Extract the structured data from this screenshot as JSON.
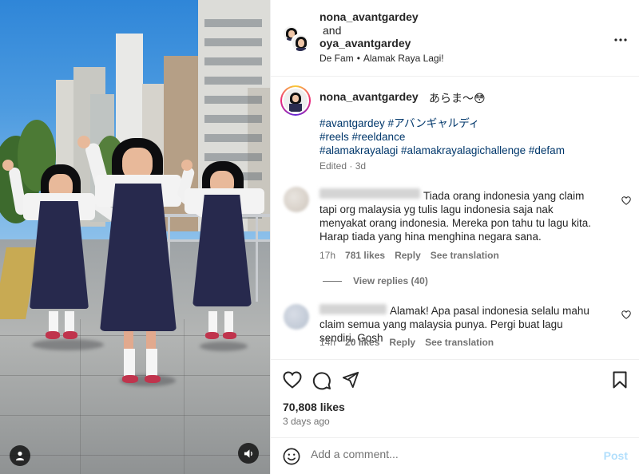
{
  "header": {
    "owner1": "nona_avantgardey",
    "connector": "and",
    "owner2": "oya_avantgardey",
    "audio_artist": "De Fam",
    "audio_separator": "•",
    "audio_title": "Alamak Raya Lagi!",
    "more_icon": "more-horizontal-icon"
  },
  "caption": {
    "username": "nona_avantgardey",
    "text": "あらま〜😳",
    "hashtags": [
      "#avantgardey #アバンギャルディ",
      "#reels #reeldance",
      "#alamakrayalagi #alamakrayalagichallenge #defam"
    ],
    "edited": "Edited · 3d"
  },
  "comments": [
    {
      "text": "Tiada orang indonesia yang claim tapi org malaysia yg tulis lagu indonesia saja nak menyakat orang indonesia. Mereka pon tahu tu lagu kita. Harap tiada yang hina menghina negara sana.",
      "time": "17h",
      "likes": "781 likes",
      "reply": "Reply",
      "translate": "See translation",
      "view_replies": "View replies (40)"
    },
    {
      "text": "Alamak! Apa pasal indonesia selalu mahu claim semua yang malaysia punya. Pergi buat lagu sendiri. Gosh",
      "time": "14h",
      "likes": "20 likes",
      "reply": "Reply",
      "translate": "See translation"
    }
  ],
  "actions": {
    "like_icon": "heart-icon",
    "comment_icon": "comment-icon",
    "share_icon": "share-icon",
    "save_icon": "bookmark-icon"
  },
  "stats": {
    "likes": "70,808 likes",
    "posted": "3 days ago"
  },
  "add_comment": {
    "placeholder": "Add a comment...",
    "post_label": "Post",
    "emoji_icon": "emoji-icon"
  },
  "colors": {
    "link": "#00376b",
    "muted": "#737373",
    "post_disabled": "#b2dffc",
    "uniform": "#27294d"
  }
}
